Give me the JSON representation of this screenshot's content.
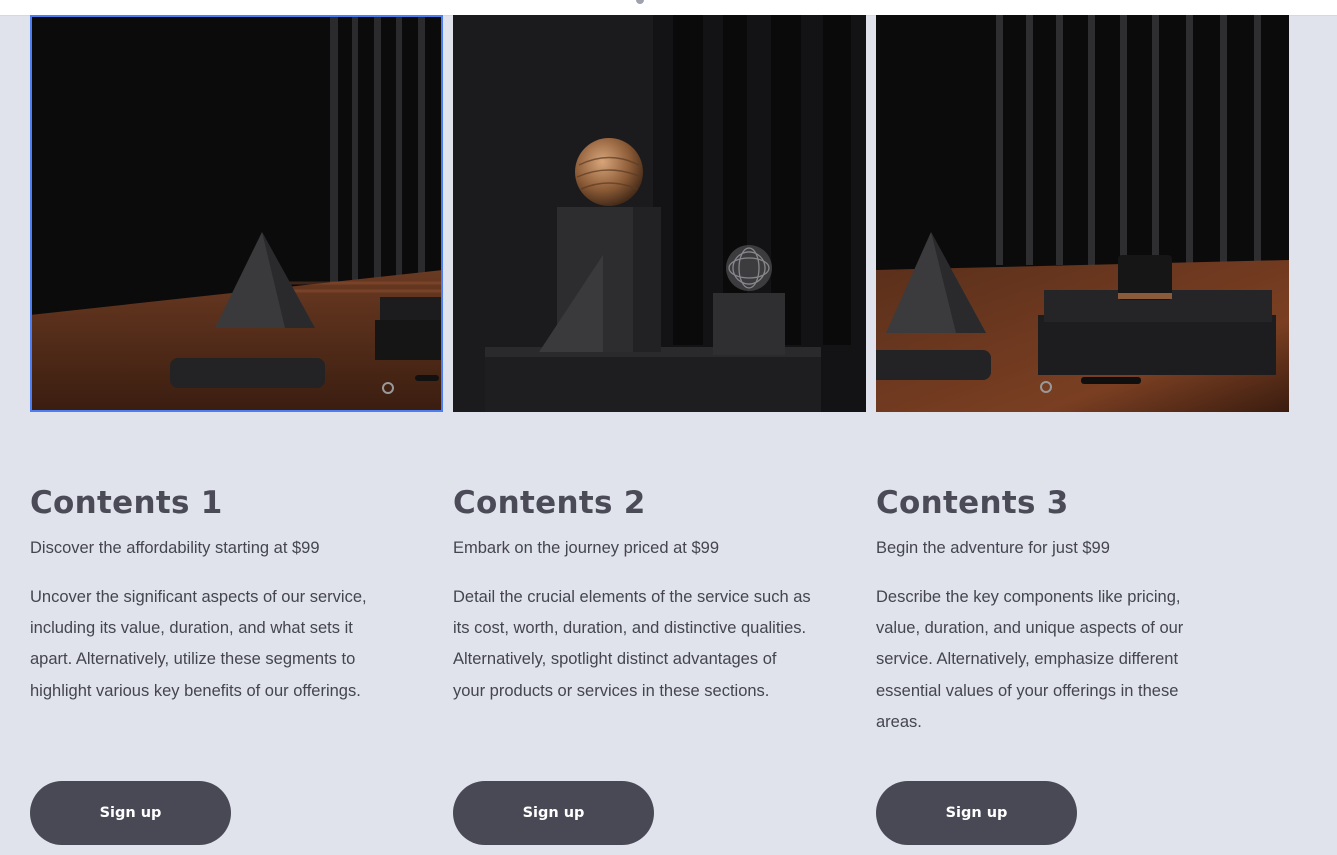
{
  "cards": [
    {
      "image_alt": "Dark still life with a stone pyramid, a ridged block and keys on a wooden table",
      "title": "Contents 1",
      "price": "Discover the affordability starting at $99",
      "description": "Uncover the significant aspects of our service, including its value, duration, and what sets it apart. Alternatively, utilize these segments to highlight various key benefits of our offerings.",
      "button_label": "Sign up"
    },
    {
      "image_alt": "Dark still life with a copper sphere on a black block and a wire sphere",
      "title": "Contents 2",
      "price": "Embark on the journey priced at $99",
      "description": "Detail the crucial elements of the service such as its cost, worth, duration, and distinctive qualities. Alternatively, spotlight distinct advantages of your products or services in these sections.",
      "button_label": "Sign up"
    },
    {
      "image_alt": "Dark still life with a stone pyramid, stacked black boxes and a candle",
      "title": "Contents 3",
      "price": "Begin the adventure for just $99",
      "description": "Describe the key components like pricing, value, duration, and unique aspects of our service. Alternatively, emphasize different essential values of your offerings in these areas.",
      "button_label": "Sign up"
    }
  ],
  "colors": {
    "background": "#e0e2ec",
    "text": "#44454f",
    "heading": "#4a4b57",
    "button": "#484955",
    "selection": "#4c7ef3"
  }
}
